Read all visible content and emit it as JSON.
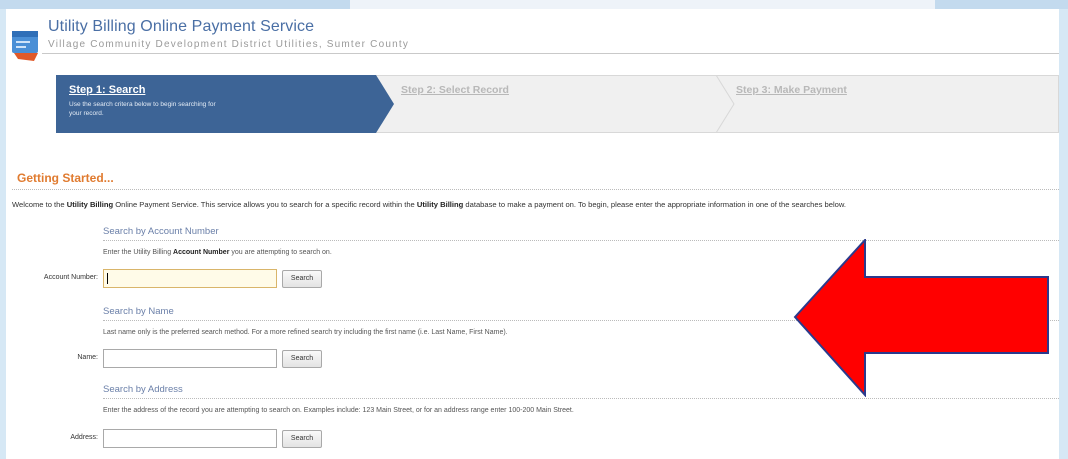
{
  "header": {
    "title": "Utility Billing Online Payment Service",
    "subtitle": "Village Community Development District Utilities, Sumter County"
  },
  "steps": [
    {
      "title": "Step 1: Search",
      "desc": "Use the search critera below to begin searching for your record.",
      "active": true
    },
    {
      "title": "Step 2: Select Record",
      "active": false
    },
    {
      "title": "Step 3: Make Payment",
      "active": false
    }
  ],
  "intro": {
    "heading": "Getting Started...",
    "welcome_pre": "Welcome to the ",
    "welcome_b1": "Utility Billing",
    "welcome_mid": " Online Payment Service. This service allows you to search for a specific record within the ",
    "welcome_b2": "Utility Billing",
    "welcome_post": " database to make a payment on. To begin, please enter the appropriate information in one of the searches below."
  },
  "sections": {
    "account": {
      "title": "Search by Account Number",
      "desc_pre": "Enter the Utility Billing ",
      "desc_b": "Account Number",
      "desc_post": " you are attempting to search on.",
      "label": "Account Number:",
      "value": "",
      "button": "Search"
    },
    "name": {
      "title": "Search by Name",
      "desc": "Last name only is the preferred search method. For a more refined search try including the first name (i.e. Last Name, First Name).",
      "label": "Name:",
      "value": "",
      "button": "Search"
    },
    "address": {
      "title": "Search by Address",
      "desc": "Enter the address of the record you are attempting to search on. Examples include: 123 Main Street, or for an address range enter 100-200 Main Street.",
      "label": "Address:",
      "value": "",
      "button": "Search"
    }
  },
  "annotation": {
    "arrow_color": "#ff0000",
    "arrow_outline": "#2b3a8c",
    "icon": "arrow-left-icon"
  },
  "colors": {
    "step_active": "#3d6496",
    "accent_orange": "#e07b30",
    "section_title": "#6a7fa8"
  }
}
